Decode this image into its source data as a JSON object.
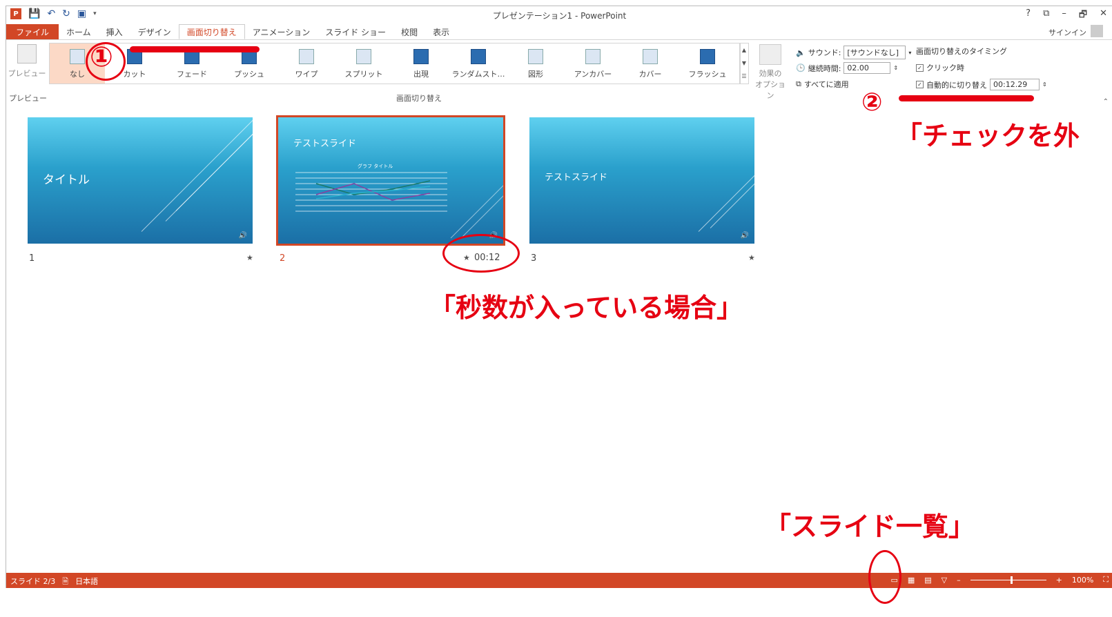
{
  "app": {
    "window_title": "プレゼンテーション1 - PowerPoint",
    "logo_label": "P",
    "window_controls": [
      "?",
      "⧉",
      "–",
      "🗗",
      "✕"
    ],
    "sign_in": "サインイン"
  },
  "tabs": [
    {
      "label": "ファイル"
    },
    {
      "label": "ホーム"
    },
    {
      "label": "挿入"
    },
    {
      "label": "デザイン"
    },
    {
      "label": "画面切り替え"
    },
    {
      "label": "アニメーション"
    },
    {
      "label": "スライド ショー"
    },
    {
      "label": "校閲"
    },
    {
      "label": "表示"
    }
  ],
  "ribbon": {
    "preview_button": "プレビュー",
    "preview_group": "プレビュー",
    "transitions_group": "画面切り替え",
    "effects": [
      {
        "label": "なし",
        "icon": "none-transition-icon"
      },
      {
        "label": "カット",
        "icon": "cut-transition-icon"
      },
      {
        "label": "フェード",
        "icon": "fade-transition-icon"
      },
      {
        "label": "プッシュ",
        "icon": "push-transition-icon"
      },
      {
        "label": "ワイプ",
        "icon": "wipe-transition-icon"
      },
      {
        "label": "スプリット",
        "icon": "split-transition-icon"
      },
      {
        "label": "出現",
        "icon": "reveal-transition-icon"
      },
      {
        "label": "ランダムスト…",
        "icon": "random-bars-transition-icon"
      },
      {
        "label": "図形",
        "icon": "shape-transition-icon"
      },
      {
        "label": "アンカバー",
        "icon": "uncover-transition-icon"
      },
      {
        "label": "カバー",
        "icon": "cover-transition-icon"
      },
      {
        "label": "フラッシュ",
        "icon": "flash-transition-icon"
      }
    ],
    "effect_options": "効果の\nオプション",
    "sound_label": "サウンド:",
    "sound_value": "[サウンドなし]",
    "duration_label": "継続時間:",
    "duration_value": "02.00",
    "apply_all": "すべてに適用",
    "timing_header": "画面切り替えのタイミング",
    "on_click": "クリック時",
    "auto_advance": "自動的に切り替え",
    "auto_advance_value": "00:12.29"
  },
  "slides": [
    {
      "number": "1",
      "title": "タイトル",
      "time": ""
    },
    {
      "number": "2",
      "title": "テストスライド",
      "time": "00:12",
      "chart_title": "グラフ タイトル"
    },
    {
      "number": "3",
      "title": "テストスライド",
      "time": ""
    }
  ],
  "star": "★",
  "status": {
    "slide": "スライド 2/3",
    "language": "日本語",
    "zoom": "100%"
  },
  "annotations": {
    "num1": "①",
    "num2": "②",
    "check_text": "「チェックを外",
    "seconds_text": "「秒数が入っている場合」",
    "sorter_text": "「スライド一覧」"
  },
  "colors": {
    "accent": "#d24726",
    "annotation": "#e60012"
  }
}
